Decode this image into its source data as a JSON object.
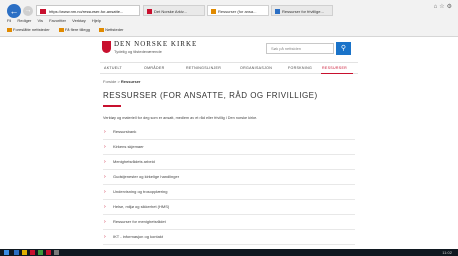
{
  "browser": {
    "address": "https://www.nm.no/ressurser-for-ansatte...",
    "tabs": [
      {
        "label": "Det Norske Arkiv...",
        "active": false,
        "color": "#c8102e"
      },
      {
        "label": "Ressurser (for ansa...",
        "active": true,
        "color": "#e08a00"
      },
      {
        "label": "Ressurser for frivillige...",
        "active": false,
        "color": "#2b6fc4"
      }
    ],
    "menu": [
      "Fil",
      "Rediger",
      "Vis",
      "Favoritter",
      "Verktøy",
      "Hjelp"
    ],
    "favorites": [
      "Foreslåtte nettsteder",
      "Få flere tillegg",
      "Nettsteder"
    ]
  },
  "site": {
    "name": "DEN NORSKE KIRKE",
    "tagline": "Tydelig og tilstedeværende",
    "brand_color": "#c8102e",
    "search_placeholder": "Søk på nettsiden",
    "search_icon": "magnifier-icon"
  },
  "nav": {
    "items": [
      "AKTUELT",
      "OMRÅDER",
      "RETNINGSLINJER",
      "ORGANISASJON",
      "FORSKNING",
      "RESSURSER"
    ],
    "active_index": 5
  },
  "breadcrumb": {
    "prefix": "Forside",
    "current": "Ressurser"
  },
  "page": {
    "title": "RESSURSER (FOR ANSATTE, RÅD OG FRIVILLIGE)",
    "intro": "Verktøy og materiell for deg som er ansatt, medlem av et råd eller frivillig i Den norske kirke."
  },
  "resources": [
    "Ressursbank",
    "Kirkens skjemaer",
    "Menighetsrådets arbeid",
    "Gudstjenester og kirkelige handlinger",
    "Undervisning og trosopplæring",
    "Helse, miljø og sikkerhet (HMS)",
    "Ressurser for menighetsrådet",
    "IKT - informasjon og kontakt"
  ],
  "taskbar": {
    "clock": "11:02"
  }
}
